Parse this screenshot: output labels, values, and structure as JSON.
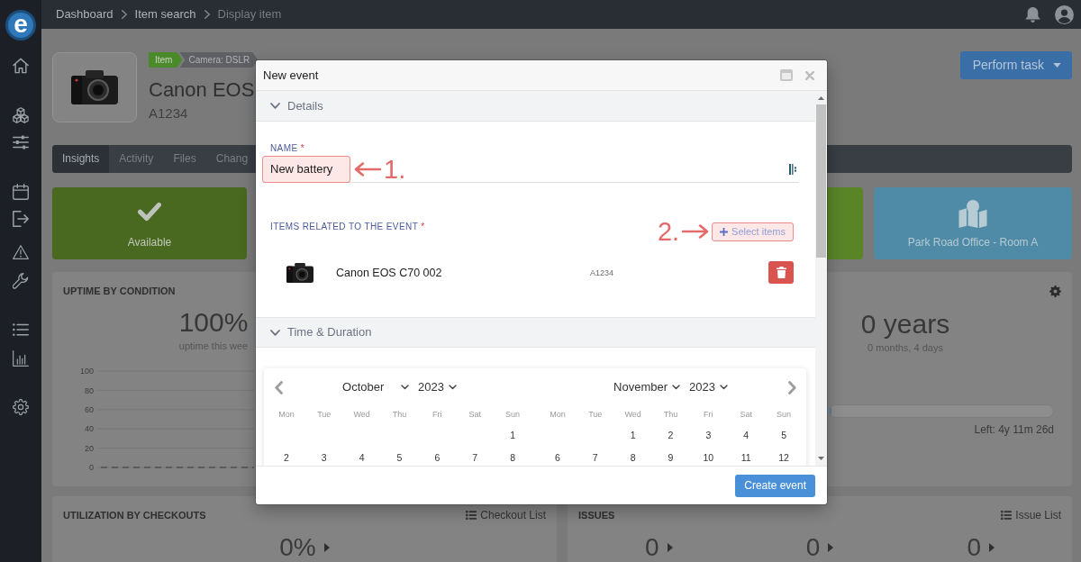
{
  "sidebar": {
    "logo": "e"
  },
  "topbar": {
    "breadcrumbs": [
      {
        "label": "Dashboard",
        "current": false
      },
      {
        "label": "Item search",
        "current": false
      },
      {
        "label": "Display item",
        "current": true
      }
    ]
  },
  "item": {
    "tags": [
      {
        "label": "Item",
        "color": "#4b8a2b"
      },
      {
        "label": "Camera: DSLR",
        "color": "#5e6063"
      }
    ],
    "title": "Canon EOS",
    "code": "A1234",
    "action": "Perform task"
  },
  "tabs": [
    {
      "label": "Insights",
      "selected": true
    },
    {
      "label": "Activity",
      "selected": false
    },
    {
      "label": "Files",
      "selected": false
    },
    {
      "label": "Chang",
      "selected": false
    }
  ],
  "status_cards": [
    {
      "kind": "status",
      "label": "Available",
      "color": "#48691f"
    },
    {
      "kind": "covered",
      "color": "#5a8527"
    },
    {
      "kind": "location",
      "label": "Park Road Office - Room A",
      "color": "#4f8ba6"
    }
  ],
  "uptime_panel": {
    "title": "UPTIME BY CONDITION",
    "value": "100%",
    "caption": "uptime this wee",
    "chart_data": {
      "type": "line",
      "grid": true,
      "ylim": [
        0,
        100
      ],
      "yticks": [
        0,
        20,
        40,
        60,
        80,
        100
      ],
      "series": [
        {
          "color": "#505050",
          "line_style": "dashed",
          "values": [
            0,
            0,
            0,
            0,
            0,
            0,
            0
          ]
        }
      ]
    }
  },
  "age_panel": {
    "value": "0 years",
    "caption": "0 months, 4 days",
    "level": 0.01,
    "remaining": "Left: 4y 11m 26d"
  },
  "utilization_panel": {
    "title": "UTILIZATION BY CHECKOUTS",
    "link": "Checkout List",
    "value": "0%"
  },
  "issues_panel": {
    "title": "ISSUES",
    "link": "Issue List",
    "values": [
      "0",
      "0",
      "0"
    ]
  },
  "dialog": {
    "title": "New event",
    "sections": [
      {
        "kind": "details",
        "title": "Details",
        "expanded": true,
        "name_field": {
          "label": "NAME",
          "required_mark": "*",
          "value": "New battery",
          "highlighted": true,
          "annotation": "1."
        },
        "items_field": {
          "label": "ITEMS RELATED TO THE EVENT",
          "required_mark": "*",
          "button": {
            "label": "Select items",
            "highlighted": true,
            "annotation": "2."
          },
          "items": [
            {
              "name": "Canon EOS C70 002",
              "code": "A1234"
            }
          ]
        }
      },
      {
        "kind": "calendar",
        "title": "Time & Duration",
        "expanded": true,
        "months": [
          {
            "month": "October",
            "year": "2023",
            "weekdays": [
              "Mon",
              "Tue",
              "Wed",
              "Thu",
              "Fri",
              "Sat",
              "Sun"
            ],
            "weeks": [
              {
                "right_aligned": true,
                "days": [
                  "1"
                ]
              },
              {
                "right_aligned": false,
                "days": [
                  "2",
                  "3",
                  "4",
                  "5",
                  "6",
                  "7",
                  "8"
                ]
              }
            ]
          },
          {
            "month": "November",
            "year": "2023",
            "weekdays": [
              "Mon",
              "Tue",
              "Wed",
              "Thu",
              "Fri",
              "Sat",
              "Sun"
            ],
            "weeks": [
              {
                "right_aligned": true,
                "days": [
                  "1",
                  "2",
                  "3",
                  "4",
                  "5"
                ]
              },
              {
                "right_aligned": false,
                "days": [
                  "6",
                  "7",
                  "8",
                  "9",
                  "10",
                  "11",
                  "12"
                ]
              }
            ]
          }
        ]
      }
    ],
    "submit": "Create event"
  }
}
